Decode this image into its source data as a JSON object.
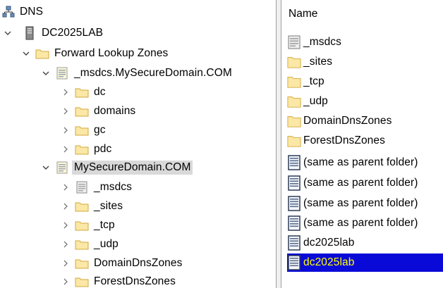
{
  "tree": {
    "items": [
      {
        "label": "DNS",
        "icon": "dns-icon",
        "expander": "none"
      },
      {
        "label": "DC2025LAB",
        "icon": "server-icon",
        "expander": "expanded"
      },
      {
        "label": "Forward Lookup Zones",
        "icon": "folder-icon",
        "expander": "expanded"
      },
      {
        "label": "_msdcs.MySecureDomain.COM",
        "icon": "zone-icon",
        "expander": "expanded"
      },
      {
        "label": "dc",
        "icon": "folder-icon",
        "expander": "collapsed"
      },
      {
        "label": "domains",
        "icon": "folder-icon",
        "expander": "collapsed"
      },
      {
        "label": "gc",
        "icon": "folder-icon",
        "expander": "collapsed"
      },
      {
        "label": "pdc",
        "icon": "folder-icon",
        "expander": "collapsed"
      },
      {
        "label": "MySecureDomain.COM",
        "icon": "zone-icon",
        "expander": "expanded",
        "selected": true
      },
      {
        "label": "_msdcs",
        "icon": "delegated-zone-icon",
        "expander": "collapsed"
      },
      {
        "label": "_sites",
        "icon": "folder-icon",
        "expander": "collapsed"
      },
      {
        "label": "_tcp",
        "icon": "folder-icon",
        "expander": "collapsed"
      },
      {
        "label": "_udp",
        "icon": "folder-icon",
        "expander": "collapsed"
      },
      {
        "label": "DomainDnsZones",
        "icon": "folder-icon",
        "expander": "collapsed"
      },
      {
        "label": "ForestDnsZones",
        "icon": "folder-icon",
        "expander": "collapsed"
      }
    ]
  },
  "list": {
    "column_header": "Name",
    "items": [
      {
        "label": "_msdcs",
        "icon": "delegated-zone-icon"
      },
      {
        "label": "_sites",
        "icon": "folder-icon"
      },
      {
        "label": "_tcp",
        "icon": "folder-icon"
      },
      {
        "label": "_udp",
        "icon": "folder-icon"
      },
      {
        "label": "DomainDnsZones",
        "icon": "folder-icon"
      },
      {
        "label": "ForestDnsZones",
        "icon": "folder-icon"
      },
      {
        "label": "(same as parent folder)",
        "icon": "record-icon"
      },
      {
        "label": "(same as parent folder)",
        "icon": "record-icon"
      },
      {
        "label": "(same as parent folder)",
        "icon": "record-icon"
      },
      {
        "label": "(same as parent folder)",
        "icon": "record-icon"
      },
      {
        "label": "dc2025lab",
        "icon": "record-icon"
      },
      {
        "label": "dc2025lab",
        "icon": "record-icon",
        "selected": true
      }
    ]
  },
  "colors": {
    "selection_blue": "#0a0ad8",
    "selection_text": "#ffff00",
    "tree_selected_gray": "#d9d9d9",
    "folder_fill": "#fbe7a6",
    "folder_stroke": "#d3a93c"
  }
}
